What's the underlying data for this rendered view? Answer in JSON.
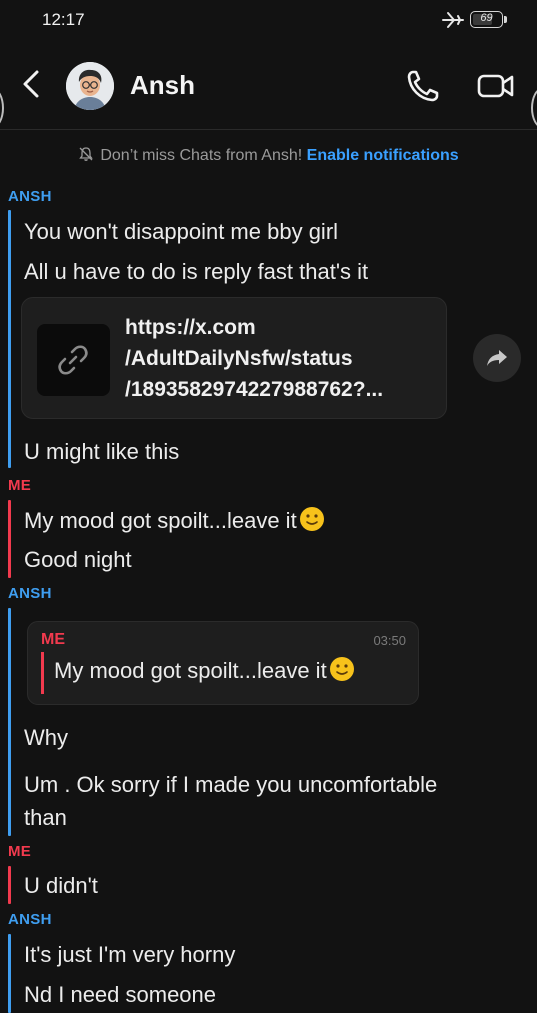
{
  "status_bar": {
    "time": "12:17",
    "battery": "69"
  },
  "header": {
    "contact_name": "Ansh"
  },
  "notice": {
    "text": "Don’t miss Chats from Ansh!",
    "link": "Enable notifications"
  },
  "messages": {
    "g1": {
      "sender": "ANSH",
      "m1": "You won't disappoint me bby girl",
      "m2": "All u have to do is reply fast that's it"
    },
    "link": {
      "line1": "https://x.com",
      "line2": "/AdultDailyNsfw/status",
      "line3": "/1893582974227988762?..."
    },
    "g1b": {
      "m3": "U might like this"
    },
    "g2": {
      "sender": "ME",
      "m1": "My mood got spoilt...leave it",
      "m2": "Good night"
    },
    "g3": {
      "sender": "ANSH",
      "quote_sender": "ME",
      "quote_time": "03:50",
      "quote_text": "My mood got spoilt...leave it",
      "m1": "Why",
      "m2_line1": "Um . Ok sorry if I made you uncomfortable",
      "m2_line2": "than"
    },
    "g4": {
      "sender": "ME",
      "m1": "U didn't"
    },
    "g5": {
      "sender": "ANSH",
      "m1": "It's just I'm very horny",
      "m2": "Nd I need someone"
    }
  },
  "colors": {
    "background": "#121212",
    "ansh": "#3f9ef0",
    "me": "#f23a4e",
    "link": "#3aa0ff"
  }
}
